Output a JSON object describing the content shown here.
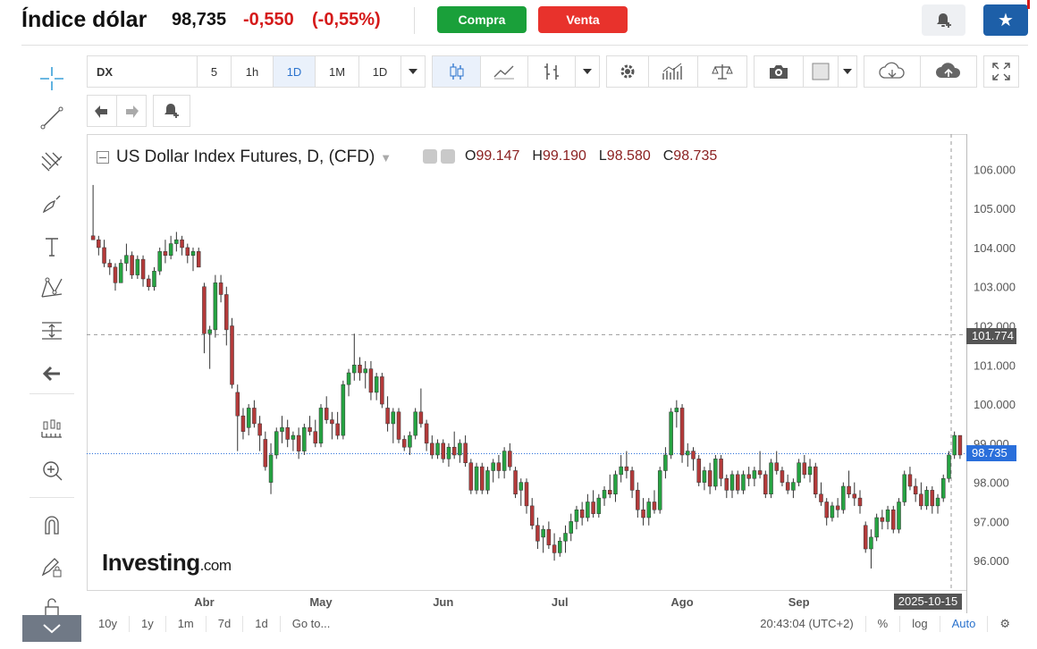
{
  "header": {
    "title": "Índice dólar",
    "price": "98,735",
    "change": "-0,550",
    "change_pct": "(-0,55%)",
    "buy_label": "Compra",
    "sell_label": "Venta",
    "buy_color": "#1aa03a",
    "sell_color": "#e8322c",
    "star_color": "#1d5fa8",
    "negative_color": "#d51a1a"
  },
  "left_toolbar": {
    "icons": [
      "crosshair-icon",
      "trendline-icon",
      "fib-icon",
      "brush-icon",
      "text-icon",
      "pattern-icon",
      "measure-icon",
      "back-arrow-icon",
      "ruler-icon",
      "zoom-in-icon",
      "magnet-icon",
      "lock-drawing-icon",
      "lock-icon"
    ]
  },
  "chart_toolbar": {
    "symbol": "DX",
    "intervals": [
      "5",
      "1h",
      "1D",
      "1M",
      "1D"
    ],
    "active_interval": "1D",
    "icons": [
      "candles-icon",
      "line-chart-icon",
      "bars-icon",
      "gear-icon",
      "indicators-icon",
      "compare-icon",
      "camera-icon",
      "color-box-icon",
      "cloud-download-icon",
      "cloud-upload-icon",
      "fullscreen-icon"
    ]
  },
  "legend": {
    "title": "US Dollar Index Futures, D, (CFD)",
    "open_label": "O",
    "open": "99.147",
    "high_label": "H",
    "high": "99.190",
    "low_label": "L",
    "low": "98.580",
    "close_label": "C",
    "close": "98.735"
  },
  "logo": {
    "main": "Investing",
    "suffix": ".com"
  },
  "chart_data": {
    "type": "candlestick",
    "x_labels": [
      "Abr",
      "May",
      "Jun",
      "Jul",
      "Ago",
      "Sep",
      "O"
    ],
    "y_ticks": [
      "106.000",
      "105.000",
      "104.000",
      "103.000",
      "102.000",
      "101.000",
      "100.000",
      "99.000",
      "98.000",
      "97.000",
      "96.000"
    ],
    "ylim": [
      95.25,
      106.9
    ],
    "crosshair_price": "101.774",
    "last_price": "98.735",
    "last_date": "2025-10-15",
    "up_color": "#26a342",
    "down_color": "#b33a3a",
    "series": [
      {
        "o": 104.3,
        "h": 105.6,
        "l": 104.2,
        "c": 104.2
      },
      {
        "o": 104.2,
        "h": 104.3,
        "l": 103.8,
        "c": 104.0
      },
      {
        "o": 104.0,
        "h": 104.2,
        "l": 103.5,
        "c": 103.6
      },
      {
        "o": 103.6,
        "h": 103.7,
        "l": 103.3,
        "c": 103.5
      },
      {
        "o": 103.5,
        "h": 103.6,
        "l": 102.9,
        "c": 103.1
      },
      {
        "o": 103.1,
        "h": 103.7,
        "l": 103.1,
        "c": 103.6
      },
      {
        "o": 103.6,
        "h": 104.1,
        "l": 103.4,
        "c": 103.8
      },
      {
        "o": 103.8,
        "h": 103.9,
        "l": 103.2,
        "c": 103.3
      },
      {
        "o": 103.3,
        "h": 103.8,
        "l": 103.2,
        "c": 103.7
      },
      {
        "o": 103.7,
        "h": 103.8,
        "l": 103.0,
        "c": 103.2
      },
      {
        "o": 103.2,
        "h": 103.3,
        "l": 102.9,
        "c": 103.0
      },
      {
        "o": 103.0,
        "h": 103.5,
        "l": 102.9,
        "c": 103.4
      },
      {
        "o": 103.4,
        "h": 104.0,
        "l": 103.3,
        "c": 103.9
      },
      {
        "o": 103.9,
        "h": 104.2,
        "l": 103.6,
        "c": 103.8
      },
      {
        "o": 103.8,
        "h": 104.3,
        "l": 103.7,
        "c": 104.1
      },
      {
        "o": 104.1,
        "h": 104.4,
        "l": 103.9,
        "c": 104.2
      },
      {
        "o": 104.2,
        "h": 104.3,
        "l": 103.8,
        "c": 104.0
      },
      {
        "o": 104.0,
        "h": 104.1,
        "l": 103.6,
        "c": 103.8
      },
      {
        "o": 103.8,
        "h": 104.0,
        "l": 103.4,
        "c": 103.9
      },
      {
        "o": 103.9,
        "h": 104.0,
        "l": 103.5,
        "c": 103.5
      },
      {
        "o": 103.0,
        "h": 103.1,
        "l": 101.3,
        "c": 101.8
      },
      {
        "o": 101.8,
        "h": 102.0,
        "l": 100.9,
        "c": 101.9
      },
      {
        "o": 101.9,
        "h": 103.3,
        "l": 101.7,
        "c": 103.1
      },
      {
        "o": 103.1,
        "h": 103.3,
        "l": 102.6,
        "c": 102.8
      },
      {
        "o": 102.8,
        "h": 103.0,
        "l": 101.5,
        "c": 101.9
      },
      {
        "o": 102.0,
        "h": 102.2,
        "l": 100.4,
        "c": 100.5
      },
      {
        "o": 100.3,
        "h": 100.5,
        "l": 98.8,
        "c": 99.7
      },
      {
        "o": 99.7,
        "h": 99.9,
        "l": 99.1,
        "c": 99.3
      },
      {
        "o": 99.4,
        "h": 100.0,
        "l": 99.2,
        "c": 99.9
      },
      {
        "o": 99.9,
        "h": 100.1,
        "l": 99.4,
        "c": 99.5
      },
      {
        "o": 99.5,
        "h": 99.7,
        "l": 98.8,
        "c": 99.2
      },
      {
        "o": 99.1,
        "h": 99.3,
        "l": 98.3,
        "c": 98.4
      },
      {
        "o": 98.0,
        "h": 99.0,
        "l": 97.7,
        "c": 98.7
      },
      {
        "o": 98.7,
        "h": 99.4,
        "l": 98.6,
        "c": 99.3
      },
      {
        "o": 99.3,
        "h": 99.7,
        "l": 99.0,
        "c": 99.4
      },
      {
        "o": 99.4,
        "h": 99.6,
        "l": 98.9,
        "c": 99.1
      },
      {
        "o": 99.1,
        "h": 99.3,
        "l": 98.8,
        "c": 99.2
      },
      {
        "o": 99.2,
        "h": 99.4,
        "l": 98.6,
        "c": 98.8
      },
      {
        "o": 98.8,
        "h": 99.5,
        "l": 98.7,
        "c": 99.4
      },
      {
        "o": 99.4,
        "h": 99.7,
        "l": 99.2,
        "c": 99.3
      },
      {
        "o": 99.3,
        "h": 99.6,
        "l": 98.9,
        "c": 99.0
      },
      {
        "o": 99.0,
        "h": 100.0,
        "l": 98.9,
        "c": 99.9
      },
      {
        "o": 99.9,
        "h": 100.2,
        "l": 99.5,
        "c": 99.6
      },
      {
        "o": 99.6,
        "h": 99.8,
        "l": 99.1,
        "c": 99.5
      },
      {
        "o": 99.5,
        "h": 99.8,
        "l": 99.1,
        "c": 99.2
      },
      {
        "o": 99.2,
        "h": 100.6,
        "l": 99.1,
        "c": 100.5
      },
      {
        "o": 100.5,
        "h": 100.9,
        "l": 100.2,
        "c": 100.8
      },
      {
        "o": 100.8,
        "h": 101.8,
        "l": 100.6,
        "c": 101.0
      },
      {
        "o": 101.0,
        "h": 101.2,
        "l": 100.6,
        "c": 100.8
      },
      {
        "o": 100.8,
        "h": 101.1,
        "l": 100.4,
        "c": 100.9
      },
      {
        "o": 100.9,
        "h": 101.1,
        "l": 100.1,
        "c": 100.3
      },
      {
        "o": 100.3,
        "h": 100.8,
        "l": 100.1,
        "c": 100.7
      },
      {
        "o": 100.7,
        "h": 100.8,
        "l": 99.9,
        "c": 100.0
      },
      {
        "o": 99.9,
        "h": 100.2,
        "l": 99.3,
        "c": 99.5
      },
      {
        "o": 99.5,
        "h": 99.9,
        "l": 99.0,
        "c": 99.8
      },
      {
        "o": 99.8,
        "h": 99.9,
        "l": 99.0,
        "c": 99.1
      },
      {
        "o": 99.1,
        "h": 99.2,
        "l": 98.8,
        "c": 98.9
      },
      {
        "o": 98.9,
        "h": 99.3,
        "l": 98.7,
        "c": 99.2
      },
      {
        "o": 99.2,
        "h": 99.9,
        "l": 99.1,
        "c": 99.8
      },
      {
        "o": 99.8,
        "h": 100.4,
        "l": 99.4,
        "c": 99.5
      },
      {
        "o": 99.5,
        "h": 99.6,
        "l": 98.8,
        "c": 99.0
      },
      {
        "o": 99.0,
        "h": 99.2,
        "l": 98.6,
        "c": 98.7
      },
      {
        "o": 98.7,
        "h": 99.1,
        "l": 98.6,
        "c": 99.0
      },
      {
        "o": 99.0,
        "h": 99.1,
        "l": 98.5,
        "c": 98.6
      },
      {
        "o": 98.6,
        "h": 99.0,
        "l": 98.4,
        "c": 98.9
      },
      {
        "o": 98.9,
        "h": 99.3,
        "l": 98.6,
        "c": 98.7
      },
      {
        "o": 98.7,
        "h": 99.1,
        "l": 98.5,
        "c": 99.0
      },
      {
        "o": 99.0,
        "h": 99.2,
        "l": 98.4,
        "c": 98.5
      },
      {
        "o": 98.5,
        "h": 98.6,
        "l": 97.7,
        "c": 97.8
      },
      {
        "o": 97.8,
        "h": 98.5,
        "l": 97.7,
        "c": 98.4
      },
      {
        "o": 98.4,
        "h": 98.5,
        "l": 97.7,
        "c": 97.8
      },
      {
        "o": 97.8,
        "h": 98.4,
        "l": 97.7,
        "c": 98.3
      },
      {
        "o": 98.3,
        "h": 98.6,
        "l": 98.0,
        "c": 98.5
      },
      {
        "o": 98.5,
        "h": 98.7,
        "l": 98.1,
        "c": 98.3
      },
      {
        "o": 98.3,
        "h": 98.9,
        "l": 98.1,
        "c": 98.8
      },
      {
        "o": 98.8,
        "h": 99.0,
        "l": 98.3,
        "c": 98.4
      },
      {
        "o": 98.3,
        "h": 98.4,
        "l": 97.6,
        "c": 97.7
      },
      {
        "o": 97.8,
        "h": 98.1,
        "l": 97.4,
        "c": 98.0
      },
      {
        "o": 98.0,
        "h": 98.1,
        "l": 97.2,
        "c": 97.4
      },
      {
        "o": 97.4,
        "h": 97.6,
        "l": 96.8,
        "c": 96.9
      },
      {
        "o": 96.9,
        "h": 97.1,
        "l": 96.3,
        "c": 96.5
      },
      {
        "o": 96.6,
        "h": 96.9,
        "l": 96.2,
        "c": 96.8
      },
      {
        "o": 96.8,
        "h": 97.0,
        "l": 96.3,
        "c": 96.4
      },
      {
        "o": 96.4,
        "h": 96.7,
        "l": 96.0,
        "c": 96.2
      },
      {
        "o": 96.2,
        "h": 96.6,
        "l": 96.1,
        "c": 96.5
      },
      {
        "o": 96.5,
        "h": 96.9,
        "l": 96.2,
        "c": 96.7
      },
      {
        "o": 96.7,
        "h": 97.2,
        "l": 96.5,
        "c": 97.0
      },
      {
        "o": 97.0,
        "h": 97.4,
        "l": 96.8,
        "c": 97.3
      },
      {
        "o": 97.3,
        "h": 97.5,
        "l": 96.9,
        "c": 97.1
      },
      {
        "o": 97.1,
        "h": 97.7,
        "l": 97.0,
        "c": 97.5
      },
      {
        "o": 97.5,
        "h": 97.8,
        "l": 97.1,
        "c": 97.2
      },
      {
        "o": 97.2,
        "h": 97.7,
        "l": 97.1,
        "c": 97.6
      },
      {
        "o": 97.6,
        "h": 97.9,
        "l": 97.4,
        "c": 97.8
      },
      {
        "o": 97.8,
        "h": 98.2,
        "l": 97.6,
        "c": 97.7
      },
      {
        "o": 97.7,
        "h": 98.3,
        "l": 97.5,
        "c": 98.2
      },
      {
        "o": 98.2,
        "h": 98.7,
        "l": 98.0,
        "c": 98.4
      },
      {
        "o": 98.4,
        "h": 98.8,
        "l": 98.1,
        "c": 98.3
      },
      {
        "o": 98.3,
        "h": 98.4,
        "l": 97.6,
        "c": 97.8
      },
      {
        "o": 97.8,
        "h": 98.0,
        "l": 97.1,
        "c": 97.3
      },
      {
        "o": 97.3,
        "h": 97.6,
        "l": 96.9,
        "c": 97.1
      },
      {
        "o": 97.1,
        "h": 97.6,
        "l": 96.9,
        "c": 97.5
      },
      {
        "o": 97.5,
        "h": 97.8,
        "l": 97.2,
        "c": 97.3
      },
      {
        "o": 97.3,
        "h": 98.4,
        "l": 97.2,
        "c": 98.3
      },
      {
        "o": 98.3,
        "h": 98.9,
        "l": 98.1,
        "c": 98.7
      },
      {
        "o": 98.7,
        "h": 99.9,
        "l": 98.6,
        "c": 99.8
      },
      {
        "o": 99.8,
        "h": 100.1,
        "l": 99.4,
        "c": 99.9
      },
      {
        "o": 99.9,
        "h": 100.0,
        "l": 98.5,
        "c": 98.7
      },
      {
        "o": 98.7,
        "h": 99.0,
        "l": 98.4,
        "c": 98.8
      },
      {
        "o": 98.8,
        "h": 98.9,
        "l": 98.3,
        "c": 98.6
      },
      {
        "o": 98.6,
        "h": 98.7,
        "l": 97.9,
        "c": 98.0
      },
      {
        "o": 98.0,
        "h": 98.4,
        "l": 97.8,
        "c": 98.3
      },
      {
        "o": 98.3,
        "h": 98.5,
        "l": 97.7,
        "c": 97.9
      },
      {
        "o": 97.9,
        "h": 98.7,
        "l": 97.8,
        "c": 98.6
      },
      {
        "o": 98.6,
        "h": 98.7,
        "l": 97.9,
        "c": 98.1
      },
      {
        "o": 98.1,
        "h": 98.2,
        "l": 97.6,
        "c": 97.8
      },
      {
        "o": 97.8,
        "h": 98.3,
        "l": 97.6,
        "c": 98.2
      },
      {
        "o": 98.2,
        "h": 98.3,
        "l": 97.7,
        "c": 97.8
      },
      {
        "o": 97.8,
        "h": 98.3,
        "l": 97.7,
        "c": 98.2
      },
      {
        "o": 98.2,
        "h": 98.4,
        "l": 97.9,
        "c": 98.1
      },
      {
        "o": 98.1,
        "h": 98.4,
        "l": 97.9,
        "c": 98.3
      },
      {
        "o": 98.3,
        "h": 98.8,
        "l": 98.1,
        "c": 98.2
      },
      {
        "o": 98.2,
        "h": 98.3,
        "l": 97.6,
        "c": 97.7
      },
      {
        "o": 97.7,
        "h": 98.6,
        "l": 97.6,
        "c": 98.5
      },
      {
        "o": 98.5,
        "h": 98.8,
        "l": 98.2,
        "c": 98.3
      },
      {
        "o": 98.3,
        "h": 98.4,
        "l": 97.9,
        "c": 98.0
      },
      {
        "o": 98.0,
        "h": 98.2,
        "l": 97.7,
        "c": 97.8
      },
      {
        "o": 97.8,
        "h": 98.1,
        "l": 97.6,
        "c": 98.0
      },
      {
        "o": 98.0,
        "h": 98.6,
        "l": 97.9,
        "c": 98.5
      },
      {
        "o": 98.5,
        "h": 98.7,
        "l": 98.1,
        "c": 98.2
      },
      {
        "o": 98.2,
        "h": 98.6,
        "l": 98.0,
        "c": 98.4
      },
      {
        "o": 98.4,
        "h": 98.5,
        "l": 97.6,
        "c": 97.7
      },
      {
        "o": 97.7,
        "h": 98.0,
        "l": 97.4,
        "c": 97.5
      },
      {
        "o": 97.5,
        "h": 97.6,
        "l": 96.9,
        "c": 97.1
      },
      {
        "o": 97.1,
        "h": 97.5,
        "l": 97.0,
        "c": 97.4
      },
      {
        "o": 97.4,
        "h": 97.6,
        "l": 97.1,
        "c": 97.3
      },
      {
        "o": 97.3,
        "h": 98.0,
        "l": 97.2,
        "c": 97.9
      },
      {
        "o": 97.9,
        "h": 98.3,
        "l": 97.6,
        "c": 97.7
      },
      {
        "o": 97.7,
        "h": 98.0,
        "l": 97.4,
        "c": 97.6
      },
      {
        "o": 97.6,
        "h": 97.8,
        "l": 97.2,
        "c": 97.4
      },
      {
        "o": 96.9,
        "h": 97.0,
        "l": 96.2,
        "c": 96.3
      },
      {
        "o": 96.3,
        "h": 96.8,
        "l": 95.8,
        "c": 96.6
      },
      {
        "o": 96.6,
        "h": 97.2,
        "l": 96.5,
        "c": 97.1
      },
      {
        "o": 97.1,
        "h": 97.3,
        "l": 96.8,
        "c": 97.0
      },
      {
        "o": 97.0,
        "h": 97.4,
        "l": 96.8,
        "c": 97.3
      },
      {
        "o": 97.3,
        "h": 97.4,
        "l": 96.7,
        "c": 96.8
      },
      {
        "o": 96.8,
        "h": 97.6,
        "l": 96.7,
        "c": 97.5
      },
      {
        "o": 97.5,
        "h": 98.3,
        "l": 97.4,
        "c": 98.2
      },
      {
        "o": 98.2,
        "h": 98.4,
        "l": 97.8,
        "c": 97.9
      },
      {
        "o": 97.9,
        "h": 98.1,
        "l": 97.5,
        "c": 97.7
      },
      {
        "o": 97.7,
        "h": 98.0,
        "l": 97.3,
        "c": 97.4
      },
      {
        "o": 97.4,
        "h": 97.9,
        "l": 97.3,
        "c": 97.8
      },
      {
        "o": 97.8,
        "h": 97.9,
        "l": 97.2,
        "c": 97.4
      },
      {
        "o": 97.4,
        "h": 97.7,
        "l": 97.2,
        "c": 97.6
      },
      {
        "o": 97.6,
        "h": 98.2,
        "l": 97.5,
        "c": 98.1
      },
      {
        "o": 98.1,
        "h": 98.8,
        "l": 98.0,
        "c": 98.7
      },
      {
        "o": 98.7,
        "h": 99.3,
        "l": 98.6,
        "c": 99.2
      },
      {
        "o": 99.2,
        "h": 99.2,
        "l": 98.6,
        "c": 98.7
      }
    ]
  },
  "bottom_bar": {
    "ranges": [
      "10y",
      "1y",
      "1m",
      "7d",
      "1d"
    ],
    "goto_label": "Go to...",
    "time": "20:43:04 (UTC+2)",
    "pct_label": "%",
    "log_label": "log",
    "auto_label": "Auto"
  }
}
